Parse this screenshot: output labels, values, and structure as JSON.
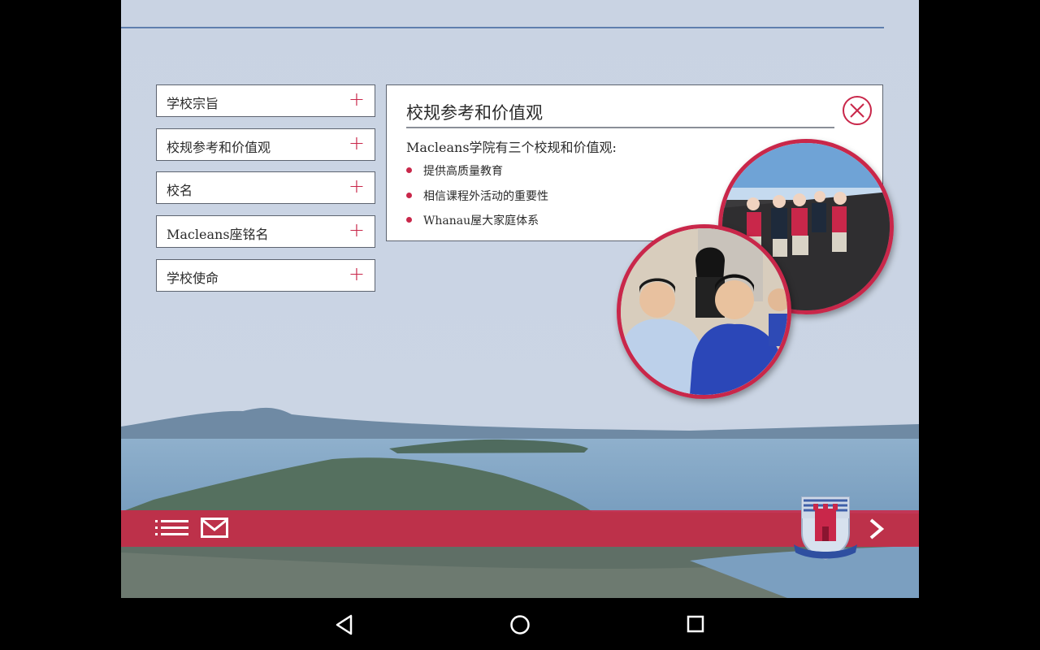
{
  "menu": {
    "items": [
      {
        "label": "学校宗旨",
        "expand_symbol": "+"
      },
      {
        "label": "校规参考和价值观",
        "expand_symbol": "+"
      },
      {
        "label": "校名",
        "expand_symbol": "+"
      },
      {
        "label": "Macleans座铭名",
        "expand_symbol": "+"
      },
      {
        "label": "学校使命",
        "expand_symbol": "+"
      }
    ]
  },
  "panel": {
    "title": "校规参考和价值观",
    "intro": "Macleans学院有三个校规和价值观:",
    "bullets": [
      "提供高质量教育",
      "相信课程外活动的重要性",
      "Whanau屋大家庭体系"
    ],
    "close_icon": "close-icon"
  },
  "photos": [
    {
      "subject": "students-hiking-beach"
    },
    {
      "subject": "students-classroom"
    }
  ],
  "crest": {
    "motto": "VIRTUE MINE HONOUR"
  },
  "bottom_bar": {
    "icons": [
      "list-menu-icon",
      "mail-icon",
      "chevron-right-icon"
    ]
  },
  "android_nav": [
    "back-icon",
    "home-icon",
    "recents-icon"
  ],
  "colors": {
    "accent": "#c9274a",
    "background": "#c8d2e2",
    "rule": "#5f7fae"
  }
}
